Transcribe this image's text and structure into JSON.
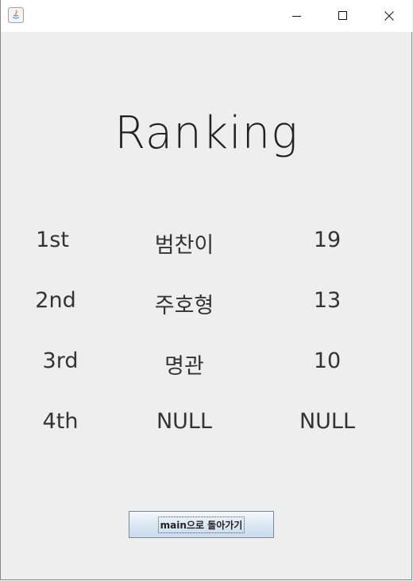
{
  "window": {
    "icon": "java-app-icon",
    "controls": [
      "minimize-icon",
      "maximize-icon",
      "close-icon"
    ]
  },
  "heading": "Ranking",
  "rows": [
    {
      "rank": "1st",
      "name": "범찬이",
      "score": "19"
    },
    {
      "rank": "2nd",
      "name": "주호형",
      "score": "13"
    },
    {
      "rank": "3rd",
      "name": "명관",
      "score": "10"
    },
    {
      "rank": "4th",
      "name": "NULL",
      "score": "NULL"
    }
  ],
  "back_button": "main으로 돌아가기",
  "colors": {
    "background": "#eeeeee",
    "titlebar": "#ffffff",
    "text": "#333333"
  }
}
